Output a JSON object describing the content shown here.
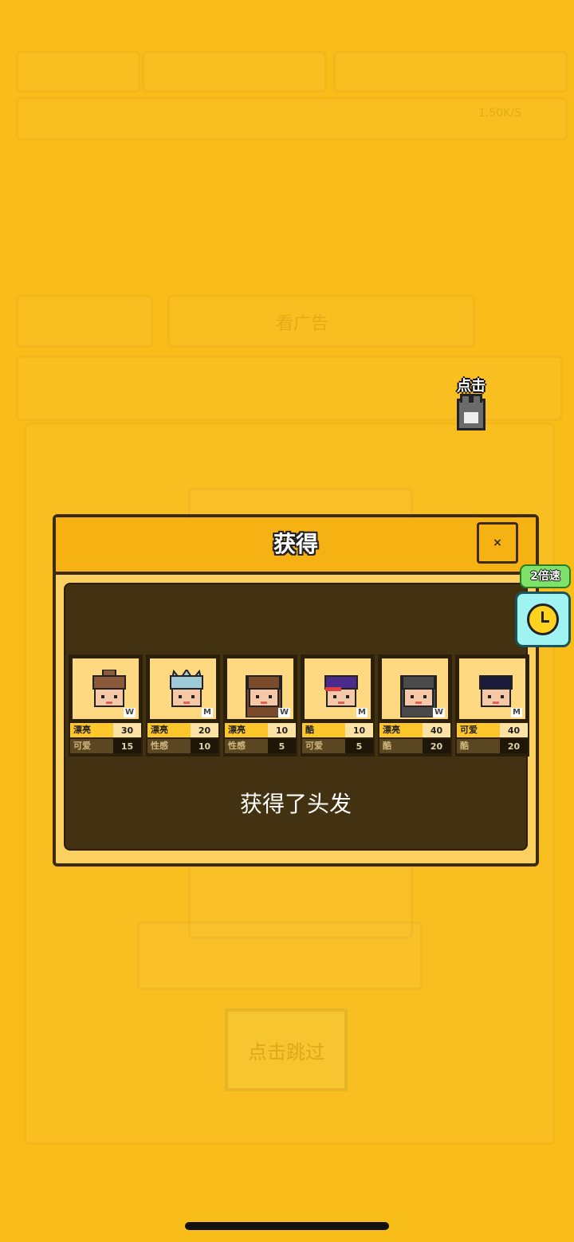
{
  "background": {
    "skip_label": "点击跳过",
    "stat_row": "1.50K/S",
    "watch_label": "看广告"
  },
  "hint": {
    "label": "点击"
  },
  "dialog": {
    "title": "获得",
    "close_label": "×",
    "message": "获得了头发"
  },
  "speed": {
    "label": "2倍速"
  },
  "items": [
    {
      "gender": "W",
      "stat1": {
        "name": "漂亮",
        "value": "30"
      },
      "stat2": {
        "name": "可爱",
        "value": "15"
      },
      "hair": "#8a5a3a",
      "style": "bun"
    },
    {
      "gender": "M",
      "stat1": {
        "name": "漂亮",
        "value": "20"
      },
      "stat2": {
        "name": "性感",
        "value": "10"
      },
      "hair": "#9fcbd8",
      "style": "spiky"
    },
    {
      "gender": "W",
      "stat1": {
        "name": "漂亮",
        "value": "10"
      },
      "stat2": {
        "name": "性感",
        "value": "5"
      },
      "hair": "#7a4a2a",
      "style": "long"
    },
    {
      "gender": "M",
      "stat1": {
        "name": "酷",
        "value": "10"
      },
      "stat2": {
        "name": "可爱",
        "value": "5"
      },
      "hair": "#4a2a8a",
      "style": "band"
    },
    {
      "gender": "W",
      "stat1": {
        "name": "漂亮",
        "value": "40"
      },
      "stat2": {
        "name": "酷",
        "value": "20"
      },
      "hair": "#4a4a4a",
      "style": "long"
    },
    {
      "gender": "M",
      "stat1": {
        "name": "可爱",
        "value": "40"
      },
      "stat2": {
        "name": "酷",
        "value": "20"
      },
      "hair": "#1a1a3a",
      "style": "short"
    }
  ]
}
